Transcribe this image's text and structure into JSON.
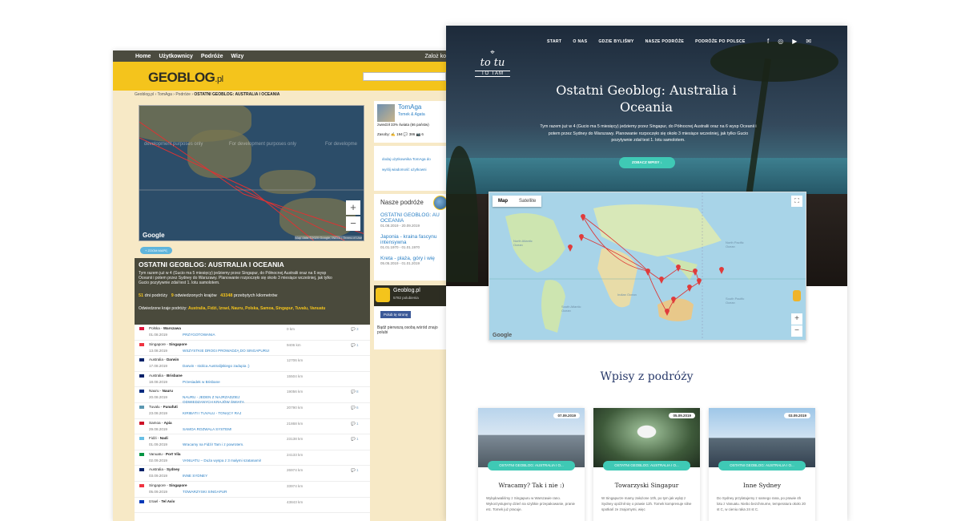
{
  "left": {
    "nav": [
      "Home",
      "Użytkownicy",
      "Podróże",
      "Wizy"
    ],
    "login": "Zaloż ko",
    "logo": "GEOBLOG",
    "logo_suffix": ".pl",
    "breadcrumb": [
      "Geoblog.pl",
      "TomAga",
      "Podróże",
      "OSTATNI GEOBLOG: AUSTRALIA I OCEANIA"
    ],
    "map": {
      "watermarks": [
        "development purposes only",
        "For development purposes only",
        "For developme"
      ],
      "attribution": "Map data ©2020 Google, INEGI | Terms of Use",
      "google": "Google",
      "zoom_in": "+",
      "zoom_out": "−",
      "zoom_map_label": "+ ZOOM MAPĘ"
    },
    "trip": {
      "title": "OSTATNI GEOBLOG: AUSTRALIA I OCEANIA",
      "desc": "Tym razem już w 4 (Gucio ma 5 miesięcy) jedziemy przez Singapur, do Północnej Australii oraz na 6 wysp Oceanii i potem przez Sydney do Warszawy. Planowanie rozpoczęło się około 3 miesiące wcześniej, jak tylko Gucio pozytywnie zdał test 1. lotu samolotem.",
      "days": "51",
      "days_label": "dni podróży",
      "countries": "9",
      "countries_label": "odwiedzonych krajów",
      "km": "43348",
      "km_label": "przebytych kilometrów",
      "visited_label": "Odwiedzone kraje podróży:",
      "visited": "Australia, Fidżi, Izrael, Nauru, Polska, Samoa, Singapur, Tuvalu, Vanuatu"
    },
    "rows": [
      {
        "place": "Polska",
        "city": "Warszawa",
        "date": "01.08.2019",
        "title": "PRZYGOTOWANIA",
        "km": "0 km",
        "comments": "3",
        "flag": "#dc143c"
      },
      {
        "place": "Singapore",
        "city": "Singapore",
        "date": "13.08.2019",
        "title": "WSZYSTKIE DROGI PROWADZĄ DO SINGAPURU!",
        "km": "9406 km",
        "comments": "1",
        "flag": "#ef3340"
      },
      {
        "place": "Australia",
        "city": "Darwin",
        "date": "17.08.2019",
        "title": "Darwin - stolica Australijskiego zadupia ;)",
        "km": "12706 km",
        "comments": "",
        "flag": "#012169"
      },
      {
        "place": "Australia",
        "city": "Brisbane",
        "date": "18.08.2019",
        "title": "Przesiadek w Brisbane",
        "km": "15504 km",
        "comments": "",
        "flag": "#012169"
      },
      {
        "place": "Nauru",
        "city": "Nauru",
        "date": "20.08.2019",
        "title": "NAURU - JEDEN Z NAJRZADZIEJ ODWIEDZANYCH KRAJÓW ŚWIATA",
        "km": "19056 km",
        "comments": "8",
        "flag": "#002b7f"
      },
      {
        "place": "Tuvalu",
        "city": "Funafuti",
        "date": "23.08.2019",
        "title": "KIRIBATI I TUVALU - TONĄCY RAJ",
        "km": "20790 km",
        "comments": "6",
        "flag": "#5b97b1"
      },
      {
        "place": "Samoa",
        "city": "Apia",
        "date": "29.08.2019",
        "title": "SAMOA ROZWALA SYSTEM!",
        "km": "21868 km",
        "comments": "1",
        "flag": "#ce1126"
      },
      {
        "place": "Fidżi",
        "city": "Nadi",
        "date": "01.09.2019",
        "title": "Wracamy na Fidżi! Tam i z powrotem.",
        "km": "23138 km",
        "comments": "1",
        "flag": "#68bfe5"
      },
      {
        "place": "Vanuatu",
        "city": "Port Vila",
        "date": "02.09.2019",
        "title": "VANUATU – Duża wyspa z 3 małymi szatanami!",
        "km": "24133 km",
        "comments": "",
        "flag": "#009543"
      },
      {
        "place": "Australia",
        "city": "Sydney",
        "date": "03.09.2019",
        "title": "INNE SYDNEY",
        "km": "26974 km",
        "comments": "1",
        "flag": "#012169"
      },
      {
        "place": "Singapore",
        "city": "Singapore",
        "date": "05.09.2019",
        "title": "TOWARZYSKI SINGAPUR",
        "km": "33974 km",
        "comments": "",
        "flag": "#ef3340"
      },
      {
        "place": "Izrael",
        "city": "Tel Aviv",
        "date": "",
        "title": "",
        "km": "43843 km",
        "comments": "",
        "flag": "#0038b8"
      }
    ],
    "profile": {
      "name": "TomAga",
      "sub": "Tomek & Agata",
      "visited": "zwiedził 33% świata (66 państw)",
      "favs": "Zasoby: ✍ 194  💬 386  📷 6"
    },
    "actions": [
      "dodaj użytkownika TomAga do",
      "wyślij wiadomość użytkowni"
    ],
    "nasze": {
      "title": "Nasze podróże",
      "items": [
        {
          "title": "OSTATNI GEOBLOG: AU OCEANIA",
          "date": "01.08.2019 - 20.09.2019"
        },
        {
          "title": "Japonia - kraina fascynu intensywna",
          "date": "01.01.1970 - 01.01.1970"
        },
        {
          "title": "Kreta - plaża, góry i wię",
          "date": "05.05.2019 - 01.01.2019"
        }
      ]
    },
    "fb": {
      "name": "Geoblog.pl",
      "likes": "5782 polubienia",
      "like": "Polub tę stronę",
      "text": "Bądź pierwszą osobą wśród znajo polubi"
    }
  },
  "right": {
    "brand_top": "to tu",
    "brand_bottom": "TO TAM",
    "nav": [
      "START",
      "O NAS",
      "GDZIE BYLIŚMY",
      "NASZE PODRÓŻE",
      "PODRÓŻE PO POLSCE"
    ],
    "social": [
      "f",
      "◎",
      "▶",
      "✉"
    ],
    "hero_title": "Ostatni Geoblog: Australia i Oceania",
    "hero_sub": "Tym razem już w 4 (Gucio ma 5 miesięcy) jedziemy przez Singapur, do Północnej Australii oraz na 6 wysp Oceanii i potem przez Sydney do Warszawy. Planowanie rozpoczęło się około 3 miesiące wcześniej, jak tylko Gucio pozytywnie zdał test 1. lotu samolotem.",
    "cta": "ZOBACZ WPISY ↓",
    "map": {
      "tab_map": "Map",
      "tab_sat": "Satellite",
      "labels": [
        "North Atlantic Ocean",
        "South Atlantic Ocean",
        "Indian Ocean",
        "North Pacific Ocean",
        "South Pacific Ocean"
      ],
      "google": "Google"
    },
    "section_title": "Wpisy z podróży",
    "cards": [
      {
        "date": "07.09.2019",
        "pill": "OSTATNI GEOBLOG: AUSTRALIA I O...",
        "title": "Wracamy? Tak i nie :)",
        "text": "Wylądowaliśmy z Singapuru w Warszawie rano. Wykorzystujemy dzień na szybkie przepakowanie, pranie etc. Tomek już pracuje.",
        "img": "city"
      },
      {
        "date": "05.09.2019",
        "pill": "OSTATNI GEOBLOG: AUSTRALIA I O...",
        "title": "Towarzyski Singapur",
        "text": "W Singapurze mamy założone 10h, po tym jak wyląt z Sydney opóźnił się o prawie 12h. Tomek kompresuje silne spotkań ze znajomymi, więc",
        "img": "jewel"
      },
      {
        "date": "03.09.2019",
        "pill": "OSTATNI GEOBLOG: AUSTRALIA I O...",
        "title": "Inne Sydney",
        "text": "Do Sydney przylatujemy z samego rana, po prawie 4h lotu z Vanuatu. Niebo bezchmurne, temperatura około 20 st C, w cieniu raka 24 st C.",
        "img": "sydney"
      }
    ]
  }
}
